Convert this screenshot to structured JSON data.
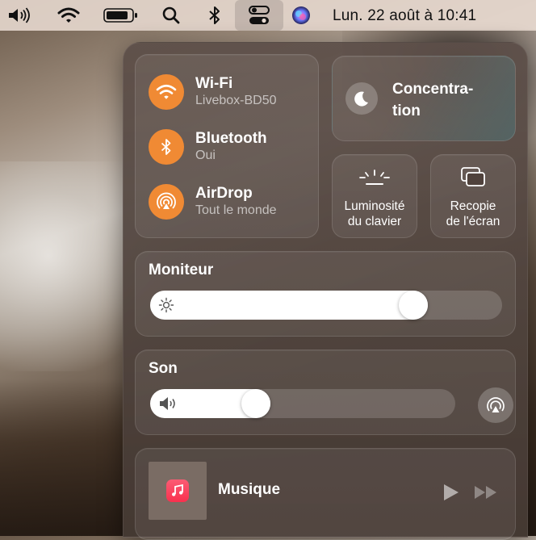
{
  "menubar": {
    "clock": "Lun. 22 août à  10:41",
    "icons": [
      "volume-icon",
      "wifi-icon",
      "battery-icon",
      "search-icon",
      "bluetooth-icon",
      "control-center-icon",
      "siri-icon"
    ]
  },
  "network": {
    "wifi": {
      "title": "Wi-Fi",
      "subtitle": "Livebox-BD50"
    },
    "bluetooth": {
      "title": "Bluetooth",
      "subtitle": "Oui"
    },
    "airdrop": {
      "title": "AirDrop",
      "subtitle": "Tout le monde"
    }
  },
  "focus": {
    "line1": "Concentra-",
    "line2": "tion"
  },
  "keyboard_brightness": {
    "line1": "Luminosité",
    "line2": "du clavier"
  },
  "screen_mirroring": {
    "line1": "Recopie",
    "line2": "de l'écran"
  },
  "display": {
    "title": "Moniteur",
    "level": 0.77
  },
  "sound": {
    "title": "Son",
    "level": 0.33
  },
  "music": {
    "title": "Musique"
  },
  "colors": {
    "accent": "#f08a34",
    "music": "#f9304e"
  }
}
